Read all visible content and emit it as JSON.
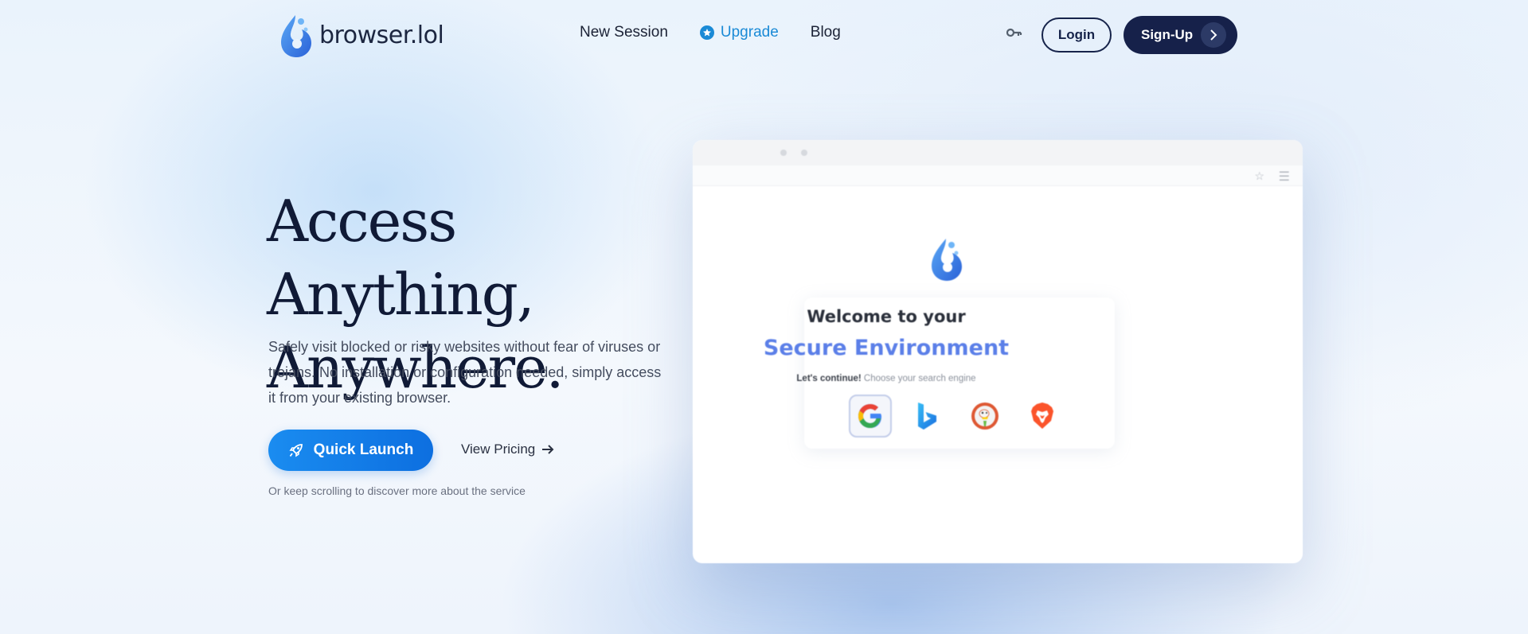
{
  "header": {
    "logo_text": "browser.lol",
    "nav": [
      {
        "label": "New Session"
      },
      {
        "label": "Upgrade"
      },
      {
        "label": "Blog"
      }
    ],
    "login_label": "Login",
    "signup_label": "Sign-Up"
  },
  "hero": {
    "title_line1": "Access Anything,",
    "title_line2": "Anywhere.",
    "description": "Safely visit blocked or risky websites without fear of viruses or trojans. No installation or configuration needed, simply access it from your existing browser.",
    "quick_launch_label": "Quick Launch",
    "view_pricing_label": "View Pricing",
    "scroll_note": "Or keep scrolling to discover more about the service"
  },
  "mock_browser": {
    "welcome": "Welcome to your",
    "secure": "Secure Environment",
    "continue_bold": "Let's continue!",
    "continue_rest": " Choose your search engine",
    "engines": [
      "Google",
      "Bing",
      "DuckDuckGo",
      "Brave"
    ]
  },
  "colors": {
    "accent": "#1a8ad6",
    "dark_navy": "#16214a",
    "primary_button": "#1a8cf0",
    "secure_text": "#5b7fe8"
  },
  "icons": {
    "upgrade": "star-icon",
    "key": "key-icon",
    "signup_arrow": "chevron-right-icon",
    "quick_launch": "rocket-icon",
    "view_pricing": "arrow-right-icon"
  }
}
